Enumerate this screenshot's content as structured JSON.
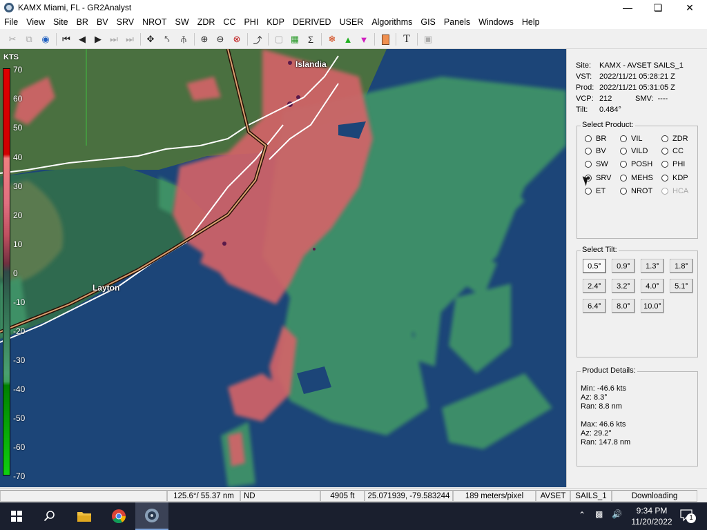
{
  "window": {
    "title": "KAMX Miami, FL - GR2Analyst"
  },
  "menu": [
    "File",
    "View",
    "Site",
    "BR",
    "BV",
    "SRV",
    "NROT",
    "SW",
    "ZDR",
    "CC",
    "PHI",
    "KDP",
    "DERIVED",
    "USER",
    "Algorithms",
    "GIS",
    "Panels",
    "Windows",
    "Help"
  ],
  "map": {
    "legend_unit": "KTS",
    "legend_ticks": [
      "70",
      "60",
      "50",
      "40",
      "30",
      "20",
      "10",
      "0",
      "-10",
      "-20",
      "-30",
      "-40",
      "-50",
      "-60",
      "-70"
    ],
    "cities": {
      "islandia": "Islandia",
      "layton": "Layton"
    },
    "colors": {
      "ocean": "#1c4578",
      "land": "#3e7a46",
      "inbound": "#3f9468",
      "outbound": "#d56468"
    }
  },
  "site_info": {
    "site_label": "Site:",
    "site": "KAMX - AVSET SAILS_1",
    "vst_label": "VST:",
    "vst": "2022/11/21  05:28:21 Z",
    "prod_label": "Prod:",
    "prod": "2022/11/21  05:31:05 Z",
    "vcp_label": "VCP:",
    "vcp": "212",
    "smv_label": "SMV:",
    "smv": "----",
    "tilt_label": "Tilt:",
    "tilt": "0.484°"
  },
  "select_product": {
    "title": "Select Product:",
    "items": [
      "BR",
      "VIL",
      "ZDR",
      "BV",
      "VILD",
      "CC",
      "SW",
      "POSH",
      "PHI",
      "SRV",
      "MEHS",
      "KDP",
      "ET",
      "NROT",
      "HCA"
    ],
    "selected": "SRV",
    "disabled": [
      "HCA"
    ]
  },
  "select_tilt": {
    "title": "Select Tilt:",
    "tilts": [
      "0.5°",
      "0.9°",
      "1.3°",
      "1.8°",
      "2.4°",
      "3.2°",
      "4.0°",
      "5.1°",
      "6.4°",
      "8.0°",
      "10.0°"
    ],
    "selected": "0.5°"
  },
  "product_details": {
    "title": "Product Details:",
    "min_line": "Min:  -46.6 kts",
    "min_az": "Az:  8.3°",
    "min_ran": "Ran:  8.8 nm",
    "max_line": "Max:  46.6 kts",
    "max_az": "Az:  29.2°",
    "max_ran": "Ran:  147.8 nm"
  },
  "status": {
    "azran": "125.6°/ 55.37 nm",
    "nd": "ND",
    "height": "4905 ft",
    "latlon": "25.071939, -79.583244",
    "resolution": "189 meters/pixel",
    "mode": "AVSET",
    "vcp_mode": "SAILS_1",
    "state": "Downloading"
  },
  "taskbar": {
    "time": "9:34 PM",
    "date": "11/20/2022",
    "notifications": "1"
  }
}
